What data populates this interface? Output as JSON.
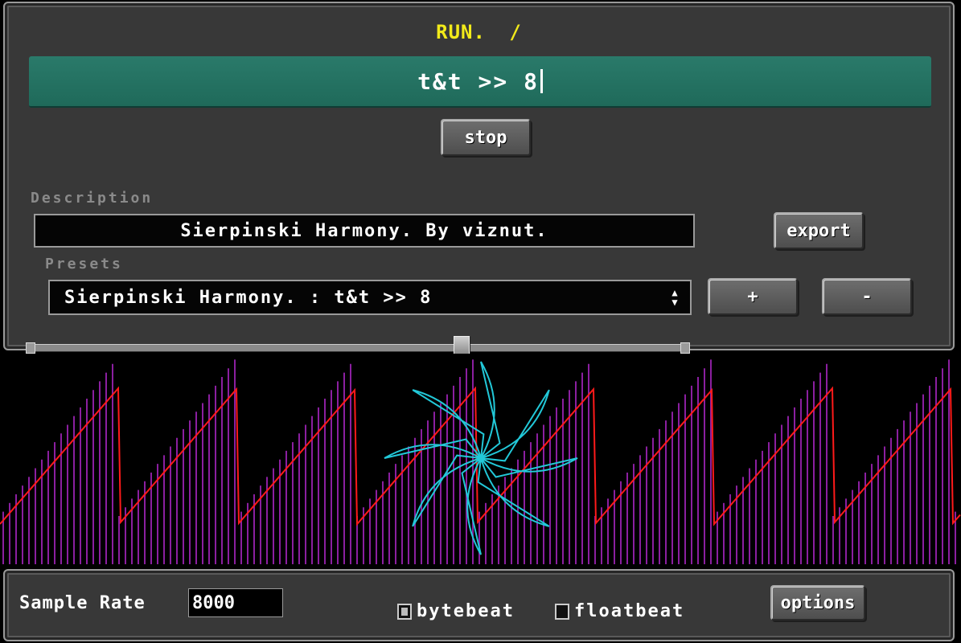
{
  "status": {
    "run_label": "RUN.",
    "spinner": "/"
  },
  "code": {
    "value": "t&t >> 8"
  },
  "controls": {
    "stop_label": "stop",
    "export_label": "export",
    "add_label": "+",
    "remove_label": "-"
  },
  "description": {
    "label": "Description",
    "value": "Sierpinski Harmony. By viznut."
  },
  "presets": {
    "label": "Presets",
    "selected": "Sierpinski Harmony. : t&t >> 8"
  },
  "footer": {
    "sample_rate_label": "Sample Rate",
    "sample_rate_value": "8000",
    "bytebeat_label": "bytebeat",
    "bytebeat_checked": true,
    "floatbeat_label": "floatbeat",
    "floatbeat_checked": false,
    "options_label": "options"
  },
  "colors": {
    "accent": "#f2ea1a",
    "code_bg": "#25705f",
    "wave": "#ff1a1a",
    "bars": "#8b1fa0",
    "shape": "#22c8d8"
  }
}
